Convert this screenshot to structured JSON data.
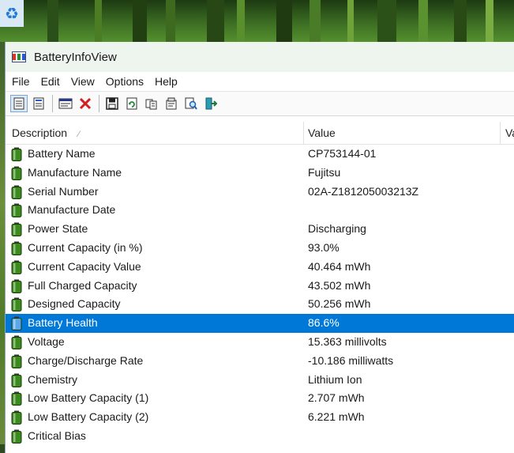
{
  "window": {
    "title": "BatteryInfoView"
  },
  "menu": [
    "File",
    "Edit",
    "View",
    "Options",
    "Help"
  ],
  "toolbar": [
    {
      "name": "html-report-icon",
      "pressed": true
    },
    {
      "name": "properties-view-icon",
      "pressed": false
    },
    {
      "sep": true
    },
    {
      "name": "log-window-icon",
      "pressed": false
    },
    {
      "name": "delete-icon",
      "pressed": false
    },
    {
      "sep": true
    },
    {
      "name": "save-icon",
      "pressed": false
    },
    {
      "name": "refresh-icon",
      "pressed": false
    },
    {
      "name": "copy-icon",
      "pressed": false
    },
    {
      "name": "properties-icon",
      "pressed": false
    },
    {
      "name": "find-icon",
      "pressed": false
    },
    {
      "name": "exit-icon",
      "pressed": false
    }
  ],
  "columns": {
    "description": "Description",
    "value": "Value",
    "value2": "Va"
  },
  "rows": [
    {
      "label": "Battery Name",
      "value": "CP753144-01"
    },
    {
      "label": "Manufacture Name",
      "value": "Fujitsu"
    },
    {
      "label": "Serial Number",
      "value": "02A-Z181205003213Z"
    },
    {
      "label": "Manufacture Date",
      "value": ""
    },
    {
      "label": "Power State",
      "value": "Discharging"
    },
    {
      "label": "Current Capacity (in %)",
      "value": "93.0%"
    },
    {
      "label": "Current Capacity Value",
      "value": "40.464 mWh"
    },
    {
      "label": "Full Charged Capacity",
      "value": "43.502 mWh"
    },
    {
      "label": "Designed Capacity",
      "value": "50.256 mWh"
    },
    {
      "label": "Battery Health",
      "value": "86.6%",
      "selected": true
    },
    {
      "label": "Voltage",
      "value": "15.363 millivolts"
    },
    {
      "label": "Charge/Discharge Rate",
      "value": "-10.186 milliwatts"
    },
    {
      "label": "Chemistry",
      "value": "Lithium Ion"
    },
    {
      "label": "Low Battery Capacity (1)",
      "value": "2.707 mWh"
    },
    {
      "label": "Low Battery Capacity (2)",
      "value": "6.221 mWh"
    },
    {
      "label": "Critical Bias",
      "value": ""
    }
  ],
  "colors": {
    "selection": "#0078d7",
    "battery_green": "#3b8a1e",
    "battery_selected": "#5aa8e8"
  }
}
